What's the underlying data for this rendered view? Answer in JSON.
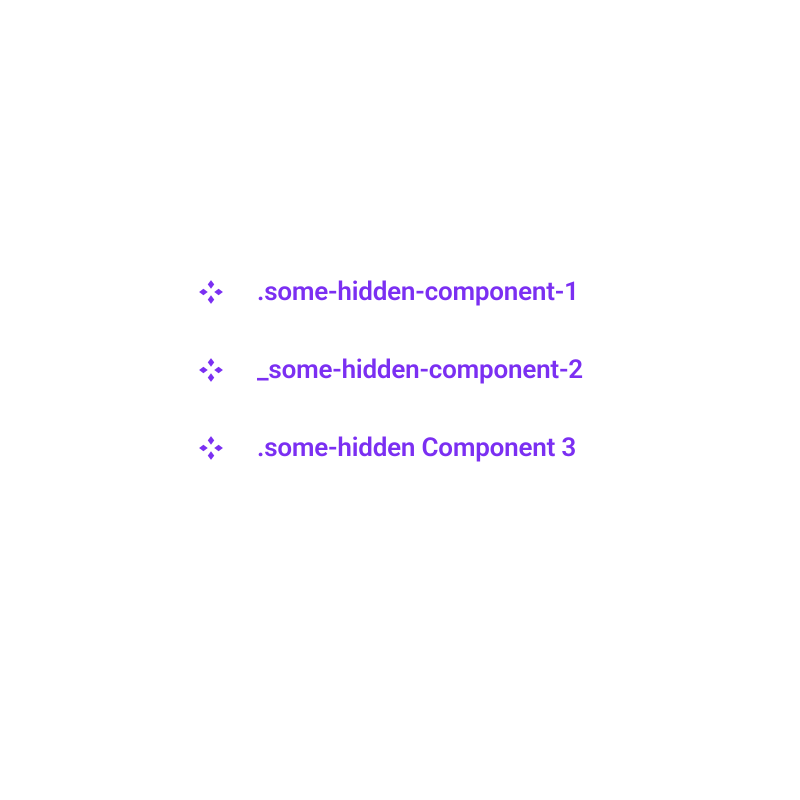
{
  "colors": {
    "accent": "#7b2ff2"
  },
  "components": [
    {
      "icon": "diamond-cluster",
      "label": ".some-hidden-component-1"
    },
    {
      "icon": "diamond-cluster",
      "label": "_some-hidden-component-2"
    },
    {
      "icon": "diamond-cluster",
      "label": ".some-hidden Component 3"
    }
  ]
}
